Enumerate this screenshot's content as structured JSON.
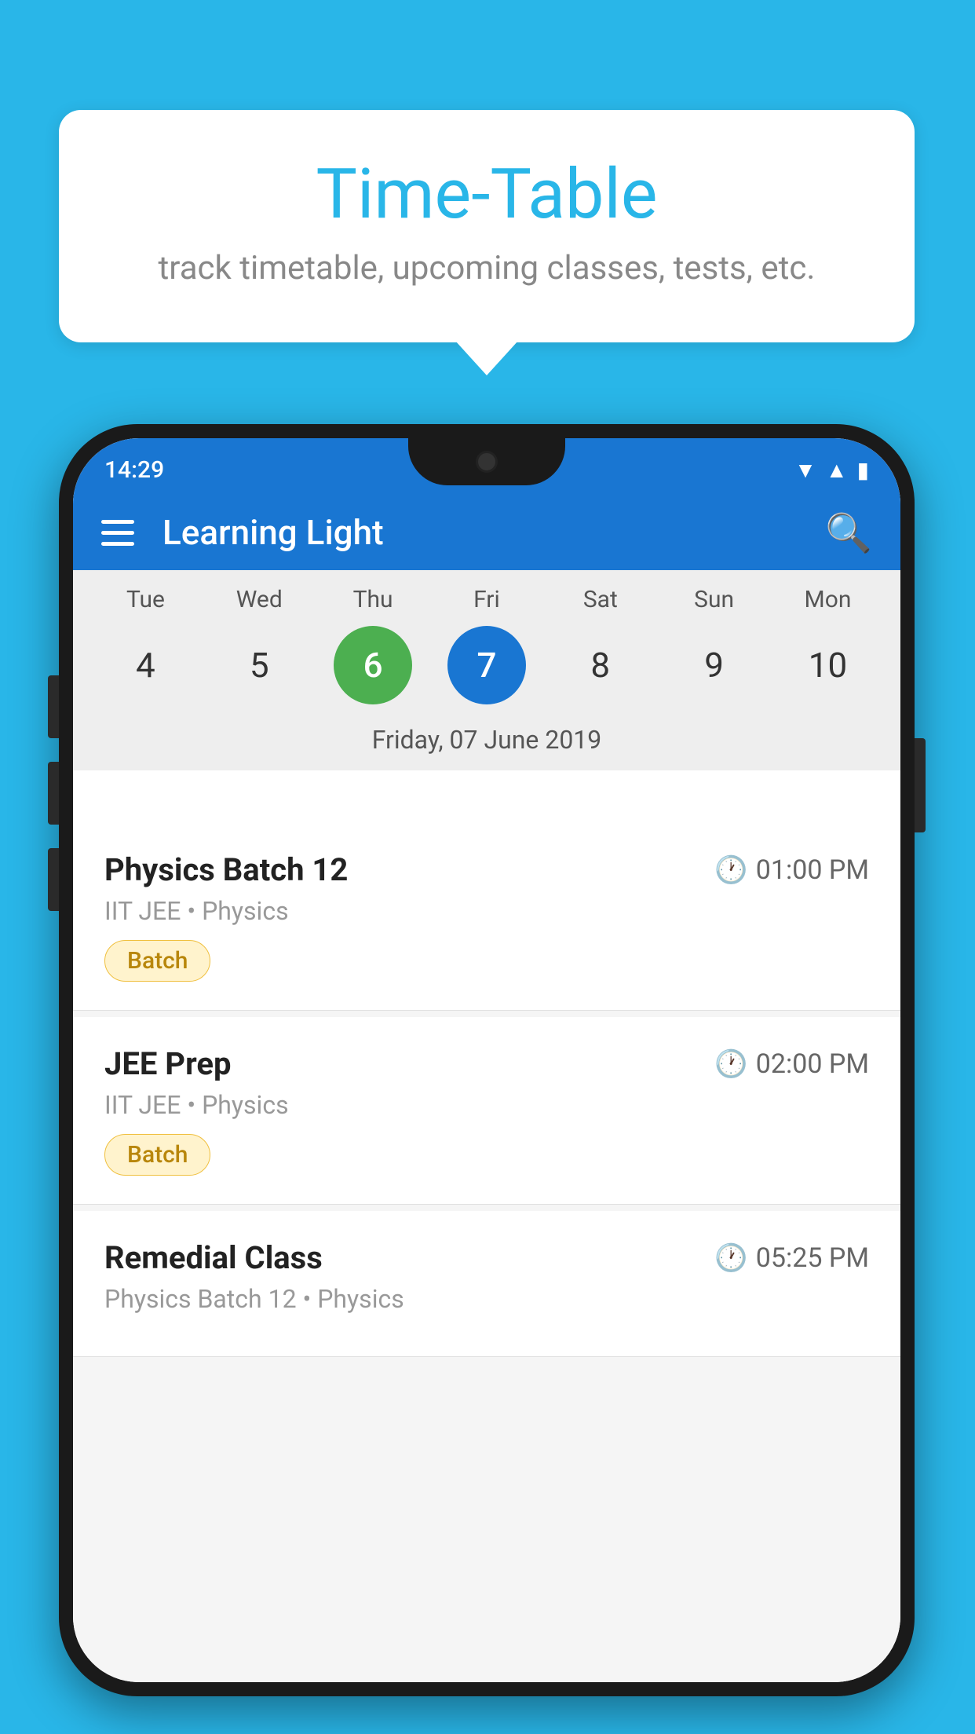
{
  "background": {
    "color": "#29b6e8"
  },
  "tooltip": {
    "title": "Time-Table",
    "subtitle": "track timetable, upcoming classes, tests, etc."
  },
  "phone": {
    "status_bar": {
      "time": "14:29"
    },
    "app_bar": {
      "title": "Learning Light",
      "menu_icon": "hamburger-icon",
      "search_icon": "search-icon"
    },
    "calendar": {
      "days": [
        {
          "label": "Tue",
          "number": "4"
        },
        {
          "label": "Wed",
          "number": "5"
        },
        {
          "label": "Thu",
          "number": "6",
          "state": "today"
        },
        {
          "label": "Fri",
          "number": "7",
          "state": "selected"
        },
        {
          "label": "Sat",
          "number": "8"
        },
        {
          "label": "Sun",
          "number": "9"
        },
        {
          "label": "Mon",
          "number": "10"
        }
      ],
      "selected_date": "Friday, 07 June 2019"
    },
    "schedule": {
      "items": [
        {
          "title": "Physics Batch 12",
          "time": "01:00 PM",
          "subtitle": "IIT JEE • Physics",
          "badge": "Batch"
        },
        {
          "title": "JEE Prep",
          "time": "02:00 PM",
          "subtitle": "IIT JEE • Physics",
          "badge": "Batch"
        },
        {
          "title": "Remedial Class",
          "time": "05:25 PM",
          "subtitle": "Physics Batch 12 • Physics",
          "badge": null
        }
      ]
    }
  }
}
